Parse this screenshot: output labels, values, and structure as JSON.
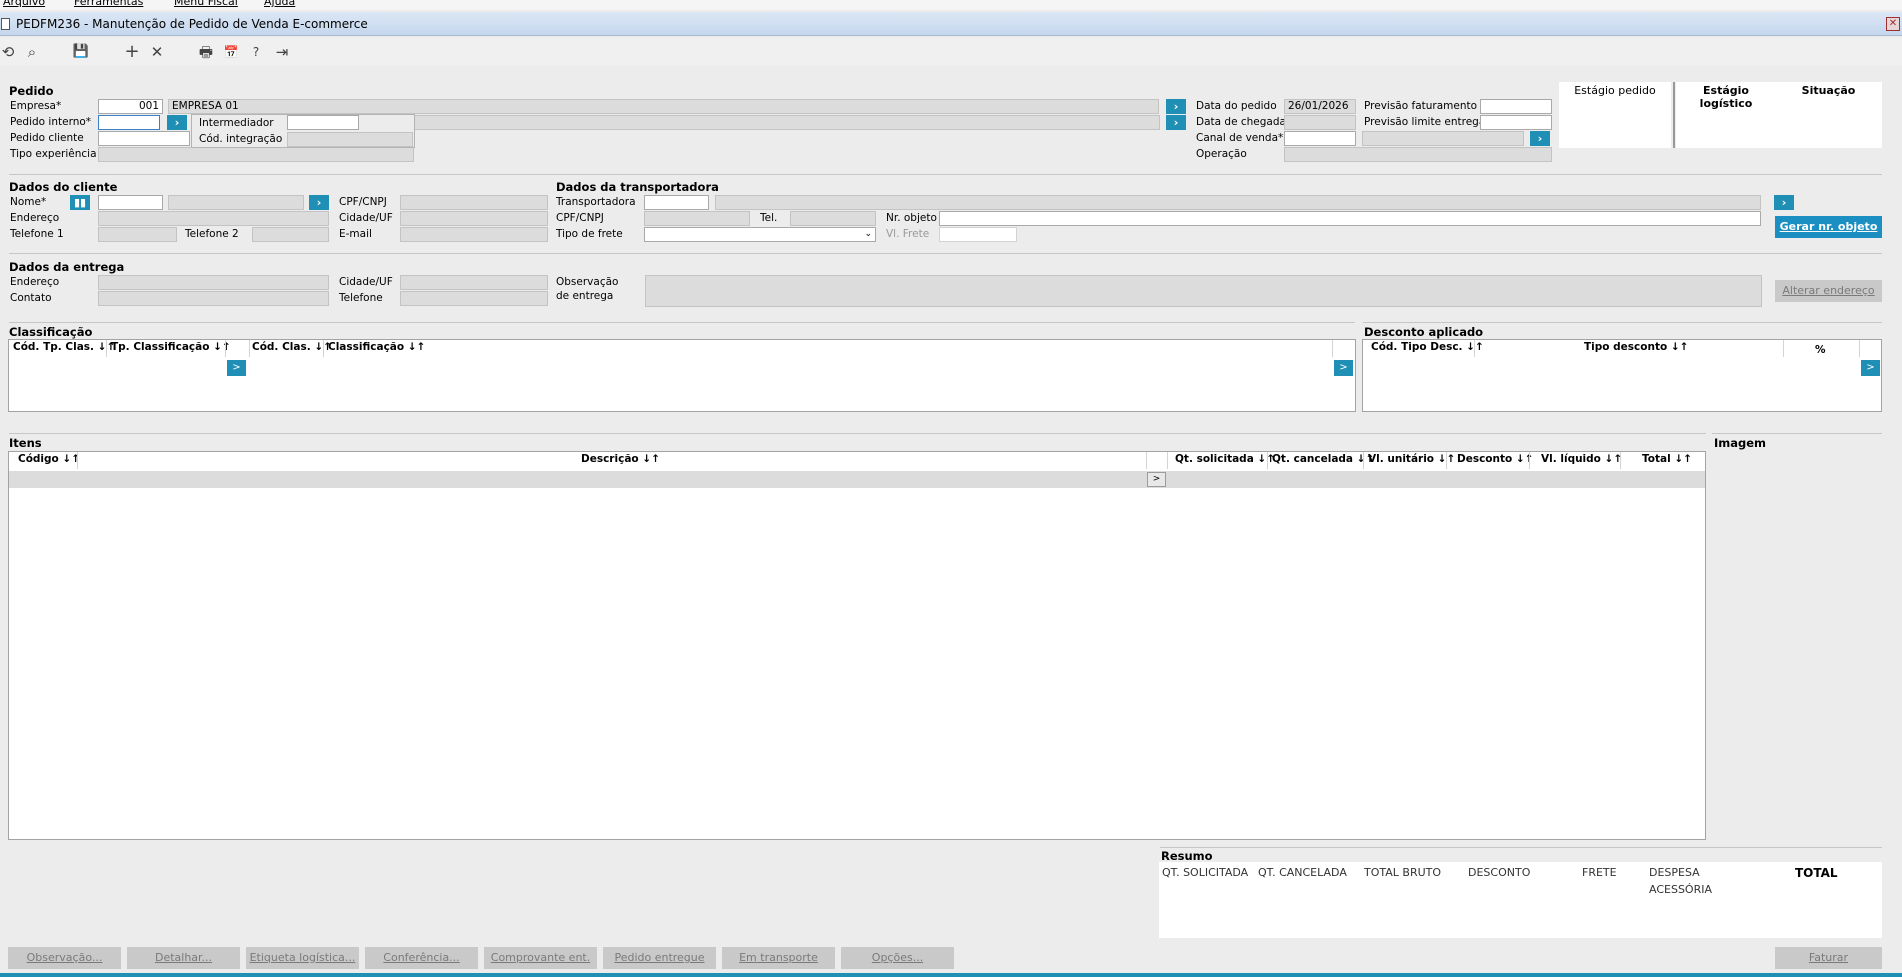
{
  "menu": {
    "arquivo": "Arquivo",
    "ferramentas": "Ferramentas",
    "menu_fiscal": "Menu Fiscal",
    "ajuda": "Ajuda"
  },
  "window": {
    "title": "PEDFM236 - Manutenção de Pedido de Venda E-commerce",
    "close": "✕"
  },
  "toolbar": {
    "refresh": "⟲",
    "search": "⌕",
    "save": "💾",
    "add": "+",
    "delete": "✕",
    "print": "🖶",
    "calendar": "📅",
    "help": "?",
    "exit": "⇥"
  },
  "pedido": {
    "section": "Pedido",
    "empresa_label": "Empresa*",
    "empresa_code": "001",
    "empresa_name": "EMPRESA 01",
    "pedido_interno_label": "Pedido interno*",
    "intermediador_label": "Intermediador",
    "pedido_cliente_label": "Pedido cliente",
    "cod_integracao_label": "Cód. integração",
    "tipo_experiencia_label": "Tipo experiência",
    "data_pedido_label": "Data do pedido",
    "data_pedido": "26/01/2026",
    "data_chegada_label": "Data de chegada",
    "canal_venda_label": "Canal de venda*",
    "operacao_label": "Operação",
    "previsao_faturamento_label": "Previsão faturamento",
    "previsao_entrega_label": "Previsão limite entrega"
  },
  "estagios": {
    "pedido": "Estágio pedido",
    "logistico": "Estágio logístico",
    "situacao": "Situação"
  },
  "cliente": {
    "section": "Dados do cliente",
    "nome_label": "Nome*",
    "endereco_label": "Endereço",
    "telefone1_label": "Telefone 1",
    "telefone2_label": "Telefone 2",
    "cpf_label": "CPF/CNPJ",
    "cidade_label": "Cidade/UF",
    "email_label": "E-mail"
  },
  "transportadora": {
    "section": "Dados da transportadora",
    "transportadora_label": "Transportadora",
    "cpf_label": "CPF/CNPJ",
    "tel_label": "Tel.",
    "nr_objeto_label": "Nr. objeto",
    "tipo_frete_label": "Tipo de frete",
    "vl_frete_label": "Vl. Frete",
    "gerar_button": "Gerar nr. objeto"
  },
  "entrega": {
    "section": "Dados da entrega",
    "endereco_label": "Endereço",
    "contato_label": "Contato",
    "cidade_label": "Cidade/UF",
    "telefone_label": "Telefone",
    "observacao_label1": "Observação",
    "observacao_label2": "de entrega",
    "alterar_button": "Alterar endereço"
  },
  "classificacao": {
    "section": "Classificação",
    "columns": [
      "Cód. Tp. Clas. ↓↑",
      "Tp. Classificação ↓↑",
      "Cód. Clas. ↓↑",
      "Classificação ↓↑"
    ]
  },
  "desconto": {
    "section": "Desconto aplicado",
    "columns": [
      "Cód. Tipo Desc. ↓↑",
      "Tipo desconto ↓↑",
      "%"
    ]
  },
  "itens": {
    "section": "Itens",
    "columns": [
      "Código ↓↑",
      "Descrição ↓↑",
      "Qt. solicitada ↓↑",
      "Qt. cancelada ↓↑",
      "Vl. unitário ↓↑",
      "Desconto ↓↑",
      "Vl. líquido ↓↑",
      "Total ↓↑"
    ],
    "row_button": ">"
  },
  "imagem": {
    "section": "Imagem"
  },
  "resumo": {
    "section": "Resumo",
    "qt_solicitada": "QT. SOLICITADA",
    "qt_cancelada": "QT. CANCELADA",
    "total_bruto": "TOTAL BRUTO",
    "desconto": "DESCONTO",
    "frete": "FRETE",
    "despesa1": "DESPESA",
    "despesa2": "ACESSÓRIA",
    "total": "TOTAL"
  },
  "footer": {
    "buttons": [
      "Observação...",
      "Detalhar...",
      "Etiqueta logística...",
      "Conferência...",
      "Comprovante ent.",
      "Pedido entregue",
      "Em transporte",
      "Opções..."
    ],
    "faturar": "Faturar"
  },
  "colors": {
    "accent": "#1f8fb5",
    "titlebar": "#c5d7ee",
    "disabled_button": "#c9c9c9"
  }
}
